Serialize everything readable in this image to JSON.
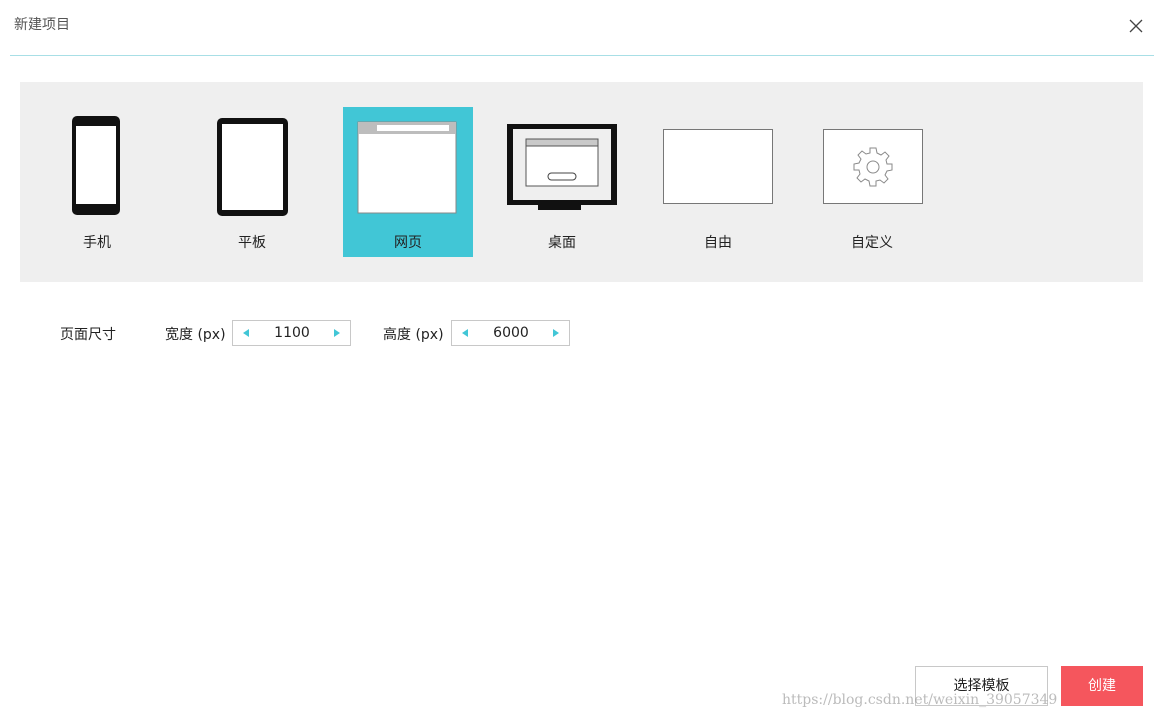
{
  "dialog": {
    "title": "新建项目",
    "close_icon": "close-icon"
  },
  "device_types": [
    {
      "key": "phone",
      "label": "手机",
      "icon": "phone-icon",
      "selected": false
    },
    {
      "key": "tablet",
      "label": "平板",
      "icon": "tablet-icon",
      "selected": false
    },
    {
      "key": "web",
      "label": "网页",
      "icon": "browser-window-icon",
      "selected": true
    },
    {
      "key": "desktop",
      "label": "桌面",
      "icon": "desktop-monitor-icon",
      "selected": false
    },
    {
      "key": "free",
      "label": "自由",
      "icon": "blank-rectangle-icon",
      "selected": false
    },
    {
      "key": "custom",
      "label": "自定义",
      "icon": "gear-icon",
      "selected": false
    }
  ],
  "page_size": {
    "label": "页面尺寸",
    "width_label": "宽度 (px)",
    "width_value": "1100",
    "height_label": "高度 (px)",
    "height_value": "6000"
  },
  "footer": {
    "template_button": "选择模板",
    "create_button": "创建"
  },
  "watermark": "https://blog.csdn.net/weixin_39057349",
  "colors": {
    "accent": "#41c6d6",
    "danger": "#f5565d",
    "panel_bg": "#efefef",
    "header_rule": "#a8dfe6"
  }
}
